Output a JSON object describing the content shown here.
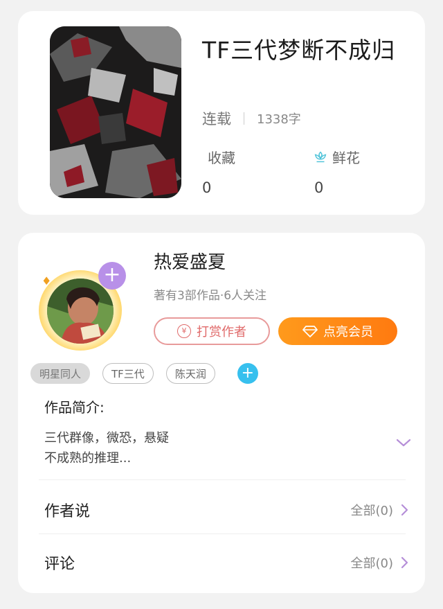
{
  "book": {
    "title": "TF三代梦断不成归",
    "status": "连载",
    "word_count": "1338字",
    "stats": {
      "favorites_label": "收藏",
      "favorites_value": "0",
      "flowers_label": "鲜花",
      "flowers_value": "0"
    }
  },
  "author": {
    "name": "热爱盛夏",
    "subtitle": "著有3部作品·6人关注",
    "tip_button": "打赏作者",
    "tip_icon_glyph": "¥",
    "vip_button": "点亮会员",
    "follow_glyph": "+"
  },
  "tags": [
    "明星同人",
    "TF三代",
    "陈天润"
  ],
  "tag_add_glyph": "+",
  "intro": {
    "label": "作品简介:",
    "line1": "三代群像，微恐，悬疑",
    "line2": "不成熟的推理..."
  },
  "sections": {
    "author_says": {
      "title": "作者说",
      "more": "全部(0)"
    },
    "comments": {
      "title": "评论",
      "more": "全部(0)"
    }
  },
  "colors": {
    "accent_purple": "#b890e8",
    "tip_red": "#e06a6a",
    "vip_orange": "#ff8a14",
    "tag_add_blue": "#37c0ee",
    "flower_teal": "#4fc3d9"
  }
}
